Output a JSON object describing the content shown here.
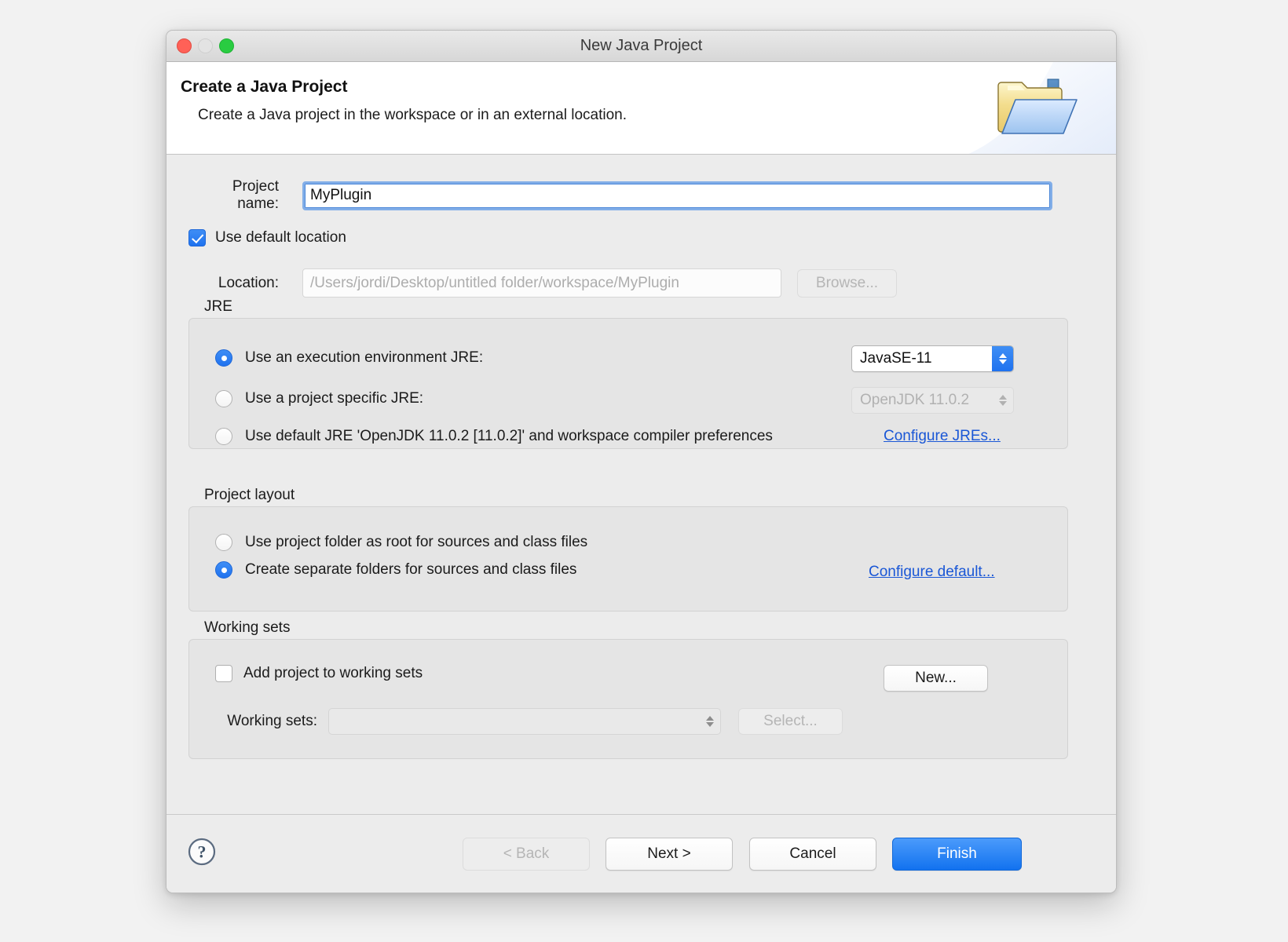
{
  "window": {
    "title": "New Java Project",
    "traffic": [
      "close-button",
      "minimize-button",
      "zoom-button"
    ]
  },
  "banner": {
    "title": "Create a Java Project",
    "subtitle": "Create a Java project in the workspace or in an external location.",
    "icon": "java-project-folder-icon"
  },
  "form": {
    "project_name_label": "Project name:",
    "project_name_value": "MyPlugin",
    "use_default_location_label": "Use default location",
    "use_default_location_checked": true,
    "location_label": "Location:",
    "location_value": "/Users/jordi/Desktop/untitled folder/workspace/MyPlugin",
    "browse_label": "Browse..."
  },
  "jre": {
    "group_label": "JRE",
    "options": [
      {
        "label": "Use an execution environment JRE:",
        "selected": true
      },
      {
        "label": "Use a project specific JRE:",
        "selected": false
      },
      {
        "label": "Use default JRE 'OpenJDK 11.0.2 [11.0.2]' and workspace compiler preferences",
        "selected": false
      }
    ],
    "execution_env_value": "JavaSE-11",
    "project_jre_value": "OpenJDK 11.0.2",
    "configure_link": "Configure JREs..."
  },
  "layout": {
    "group_label": "Project layout",
    "options": [
      {
        "label": "Use project folder as root for sources and class files",
        "selected": false
      },
      {
        "label": "Create separate folders for sources and class files",
        "selected": true
      }
    ],
    "configure_link": "Configure default..."
  },
  "working_sets": {
    "group_label": "Working sets",
    "add_checkbox_label": "Add project to working sets",
    "add_checkbox_checked": false,
    "new_button": "New...",
    "sets_label": "Working sets:",
    "sets_value": "",
    "select_button": "Select..."
  },
  "footer": {
    "help": "help-icon",
    "back": "< Back",
    "next": "Next >",
    "cancel": "Cancel",
    "finish": "Finish"
  },
  "colors": {
    "accent": "#1f72ef",
    "link": "#1a57d6",
    "close": "#ff6157",
    "zoom": "#29cc41",
    "window_bg": "#ececec"
  }
}
